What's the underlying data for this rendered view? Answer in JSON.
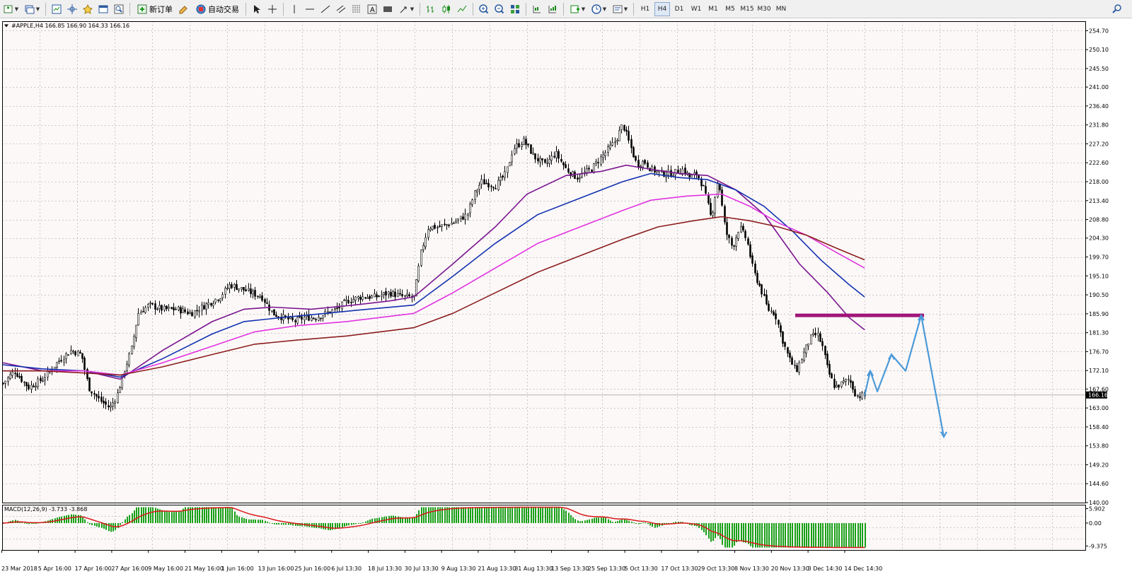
{
  "toolbar": {
    "buttons": [
      {
        "name": "new-chart-icon",
        "type": "icon",
        "drop": true
      },
      {
        "name": "profiles-icon",
        "type": "icon",
        "drop": true
      },
      {
        "type": "sep"
      },
      {
        "name": "market-watch-icon",
        "type": "icon"
      },
      {
        "name": "data-window-icon",
        "type": "icon"
      },
      {
        "name": "navigator-icon",
        "type": "icon"
      },
      {
        "name": "terminal-icon",
        "type": "icon"
      },
      {
        "name": "strategy-tester-icon",
        "type": "icon"
      },
      {
        "type": "sep"
      },
      {
        "name": "new-order-button",
        "type": "text",
        "label": "新订单",
        "icon": "new-order-icon"
      },
      {
        "name": "metaeditor-icon",
        "type": "icon"
      },
      {
        "name": "auto-trading-button",
        "type": "text",
        "label": "自动交易",
        "icon": "auto-trading-icon"
      },
      {
        "type": "sep"
      },
      {
        "name": "cursor-icon",
        "type": "icon"
      },
      {
        "name": "crosshair-icon",
        "type": "icon"
      },
      {
        "type": "sep"
      },
      {
        "name": "vertical-line-icon",
        "type": "icon"
      },
      {
        "name": "horizontal-line-icon",
        "type": "icon"
      },
      {
        "name": "trendline-icon",
        "type": "icon"
      },
      {
        "name": "equidistant-channel-icon",
        "type": "icon"
      },
      {
        "name": "fibonacci-icon",
        "type": "icon"
      },
      {
        "name": "text-icon",
        "type": "icon"
      },
      {
        "name": "text-label-icon",
        "type": "icon"
      },
      {
        "name": "arrows-icon",
        "type": "icon",
        "drop": true
      },
      {
        "type": "sep"
      },
      {
        "name": "bar-chart-icon",
        "type": "icon"
      },
      {
        "name": "candlestick-icon",
        "type": "icon"
      },
      {
        "name": "line-chart-icon",
        "type": "icon"
      },
      {
        "type": "sep"
      },
      {
        "name": "zoom-in-icon",
        "type": "icon"
      },
      {
        "name": "zoom-out-icon",
        "type": "icon"
      },
      {
        "name": "tile-windows-icon",
        "type": "icon"
      },
      {
        "type": "sep"
      },
      {
        "name": "chart-shift-icon",
        "type": "icon"
      },
      {
        "name": "auto-scroll-icon",
        "type": "icon"
      },
      {
        "type": "sep"
      },
      {
        "name": "indicators-icon",
        "type": "icon",
        "drop": true
      },
      {
        "name": "periods-icon",
        "type": "icon",
        "drop": true
      },
      {
        "name": "templates-icon",
        "type": "icon",
        "drop": true
      },
      {
        "type": "sep"
      }
    ],
    "timeframes": [
      "H1",
      "H4",
      "D1",
      "W1",
      "M1",
      "M5",
      "M15",
      "M30",
      "MN"
    ],
    "active_timeframe": "H4"
  },
  "chart": {
    "header": "#APPLE,H4  166.85 166.90 164.33 166.16",
    "current_price": "166.16",
    "macd_header": "MACD(12,26,9) -3.733 -3.868",
    "price_labels": [
      "254.70",
      "250.10",
      "245.50",
      "241.00",
      "236.40",
      "231.80",
      "227.20",
      "222.60",
      "218.00",
      "213.40",
      "208.80",
      "204.30",
      "199.70",
      "195.10",
      "190.50",
      "185.90",
      "181.30",
      "176.70",
      "172.10",
      "167.60",
      "163.00",
      "158.40",
      "153.80",
      "149.20",
      "144.60",
      "140.00"
    ],
    "macd_labels": [
      "5.902",
      "0.00",
      "-9.375"
    ],
    "time_labels": [
      "23 Mar 2018",
      "5 Apr 16:00",
      "17 Apr 16:00",
      "27 Apr 16:00",
      "9 May 16:00",
      "21 May 16:00",
      "1 Jun 16:00",
      "13 Jun 16:00",
      "25 Jun 16:00",
      "6 Jul 13:30",
      "18 Jul 13:30",
      "30 Jul 13:30",
      "9 Aug 13:30",
      "21 Aug 13:30",
      "31 Aug 13:30",
      "13 Sep 13:30",
      "25 Sep 13:30",
      "5 Oct 13:30",
      "17 Oct 13:30",
      "29 Oct 13:30",
      "8 Nov 13:30",
      "20 Nov 13:30",
      "3 Dec 14:30",
      "14 Dec 14:30"
    ],
    "colors": {
      "background": "#fdf8f8",
      "grid": "#c8c8c8",
      "candle": "#000000",
      "ma_fast": "#7a1690",
      "ma_mid": "#1232b0",
      "ma_slow": "#e034e0",
      "ma_long": "#8b1e1e",
      "resistance": "#a0157a",
      "forecast": "#4a9ad8",
      "macd_hist": "#17a017",
      "macd_signal": "#d81818"
    }
  }
}
